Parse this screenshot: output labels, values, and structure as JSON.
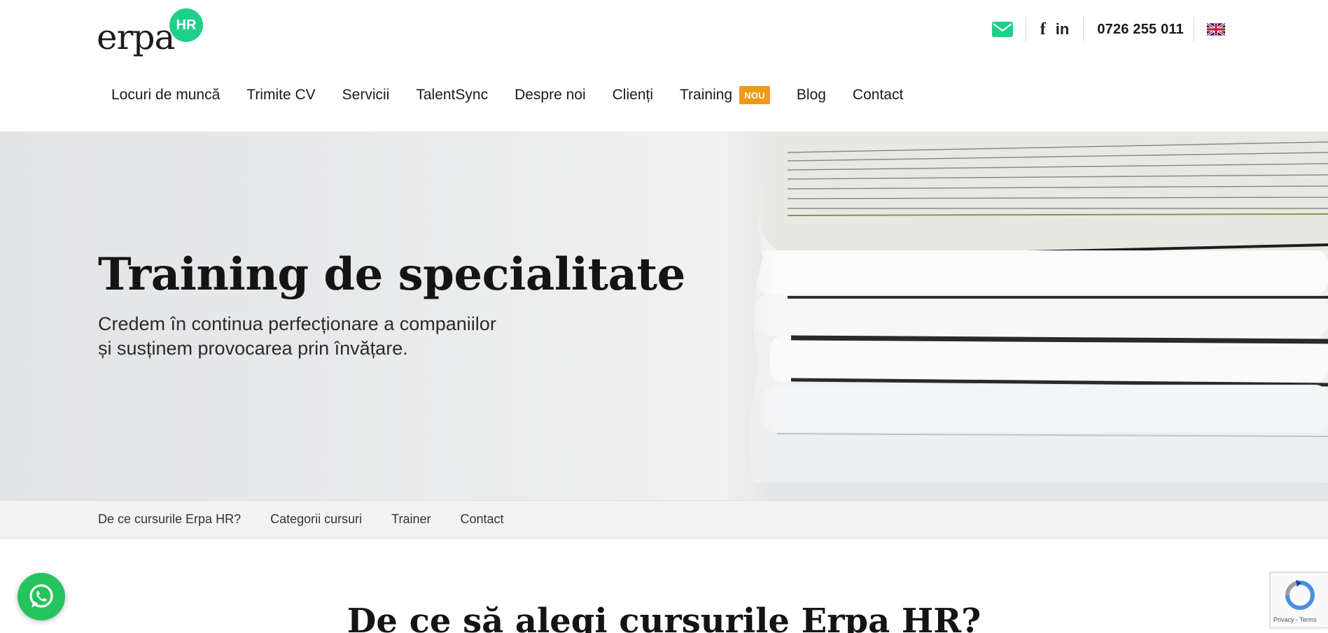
{
  "logo": {
    "text": "erpa",
    "badge": "HR"
  },
  "header": {
    "phone": "0726 255 011",
    "icons": [
      "mail-icon",
      "facebook-icon",
      "linkedin-icon",
      "uk-flag-icon"
    ],
    "facebook_glyph": "f",
    "linkedin_glyph": "in"
  },
  "nav": {
    "items": [
      {
        "label": "Locuri de muncă"
      },
      {
        "label": "Trimite CV"
      },
      {
        "label": "Servicii"
      },
      {
        "label": "TalentSync"
      },
      {
        "label": "Despre noi"
      },
      {
        "label": "Clienți"
      },
      {
        "label": "Training",
        "badge": "NOU"
      },
      {
        "label": "Blog"
      },
      {
        "label": "Contact"
      }
    ]
  },
  "hero": {
    "title": "Training de specialitate",
    "subtitle_line1": "Credem în continua perfecționare a companiilor",
    "subtitle_line2": "și susținem provocarea prin învățare."
  },
  "subnav": {
    "items": [
      {
        "label": "De ce cursurile Erpa HR?"
      },
      {
        "label": "Categorii cursuri"
      },
      {
        "label": "Trainer"
      },
      {
        "label": "Contact"
      }
    ]
  },
  "section": {
    "title": "De ce să alegi cursurile Erpa HR?"
  },
  "recaptcha": {
    "links": "Privacy - Terms"
  },
  "colors": {
    "brand_green": "#1fcf8a",
    "badge_orange": "#ee9a17",
    "whatsapp_green": "#25c35e"
  }
}
